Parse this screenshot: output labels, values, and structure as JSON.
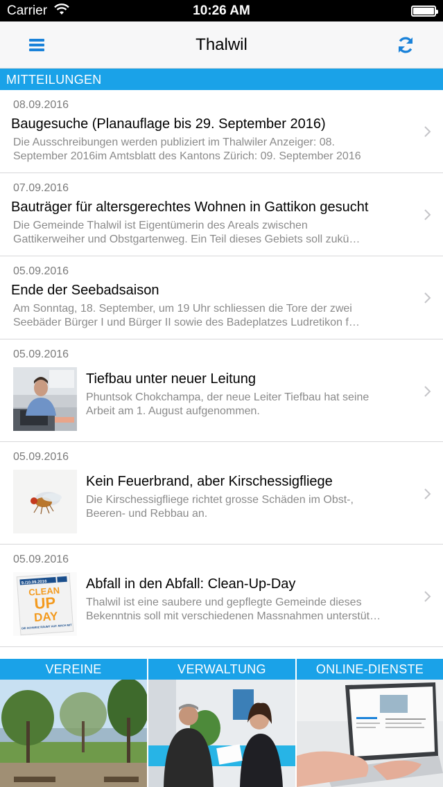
{
  "status_bar": {
    "carrier": "Carrier",
    "time": "10:26 AM"
  },
  "nav": {
    "title": "Thalwil",
    "menu_icon": "hamburger-menu-icon",
    "refresh_icon": "refresh-icon"
  },
  "section": {
    "title": "MITTEILUNGEN"
  },
  "news": [
    {
      "date": "08.09.2016",
      "title": "Baugesuche (Planauflage bis 29. September 2016)",
      "summary_line1": "Die Ausschreibungen werden publiziert im Thalwiler Anzeiger: 08.",
      "summary_line2": "September 2016im Amtsblatt des Kantons Zürich: 09. September 2016"
    },
    {
      "date": "07.09.2016",
      "title": "Bauträger für altersgerechtes Wohnen in Gattikon gesucht",
      "summary_line1": "Die Gemeinde Thalwil ist Eigentümerin des Areals zwischen",
      "summary_line2": "Gattikerweiher und Obstgartenweg. Ein Teil dieses Gebiets soll zukü…"
    },
    {
      "date": "05.09.2016",
      "title": "Ende der Seebadsaison",
      "summary_line1": "Am Sonntag, 18. September, um 19 Uhr schliessen die Tore der zwei",
      "summary_line2": "Seebäder Bürger I und Bürger II sowie des Badeplatzes Ludretikon f…"
    },
    {
      "date": "05.09.2016",
      "title": "Tiefbau unter neuer Leitung",
      "summary_line1": "Phuntsok Chokchampa, der neue Leiter Tiefbau hat seine",
      "summary_line2": "Arbeit am 1. August aufgenommen."
    },
    {
      "date": "05.09.2016",
      "title": "Kein Feuerbrand, aber Kirschessigfliege",
      "summary_line1": "Die Kirschessigfliege richtet grosse Schäden im Obst-,",
      "summary_line2": "Beeren- und Rebbau an."
    },
    {
      "date": "05.09.2016",
      "title": "Abfall in den Abfall: Clean-Up-Day",
      "summary_line1": "Thalwil ist eine saubere und gepflegte Gemeinde  dieses",
      "summary_line2": "Bekenntnis soll mit verschiedenen Massnahmen unterstüt…",
      "thumb": {
        "date_text": "9./10.09.2016",
        "line1": "CLEAN",
        "line2": "UP",
        "line3": "DAY",
        "footer": "DIE SCHWEIZ RÄUMT AUF. MACH MIT"
      }
    }
  ],
  "tiles": [
    {
      "label": "VEREINE"
    },
    {
      "label": "VERWALTUNG"
    },
    {
      "label": "ONLINE-DIENSTE"
    }
  ],
  "colors": {
    "accent": "#1aa2e8",
    "icon_blue": "#1a82d9",
    "orange": "#f39a1e"
  }
}
